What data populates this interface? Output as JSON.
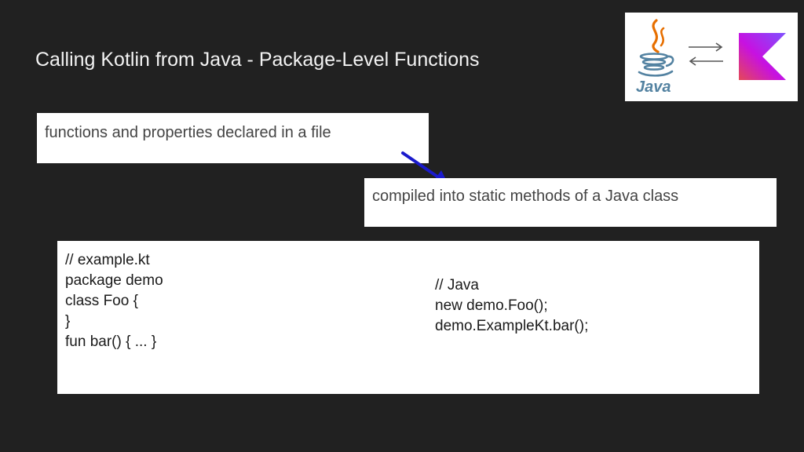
{
  "slide": {
    "title": "Calling Kotlin from Java - Package-Level Functions"
  },
  "logos": {
    "left_icon": "java-logo-icon",
    "left_wordmark": "Java",
    "middle_icon": "swap-arrows-icon",
    "right_icon": "kotlin-logo-icon"
  },
  "callouts": {
    "declared": "functions and properties declared in a file",
    "compiled": "compiled into static methods of a Java class"
  },
  "code": {
    "kotlin_lines": [
      "// example.kt",
      "package demo",
      "class Foo {",
      "}",
      "fun bar() { ... }"
    ],
    "java_lines": [
      "// Java",
      "new demo.Foo();",
      "demo.ExampleKt.bar();"
    ]
  },
  "colors": {
    "background": "#212121",
    "arrow": "#1a1acc",
    "java_orange": "#e76f00",
    "java_blue": "#5382a1"
  }
}
